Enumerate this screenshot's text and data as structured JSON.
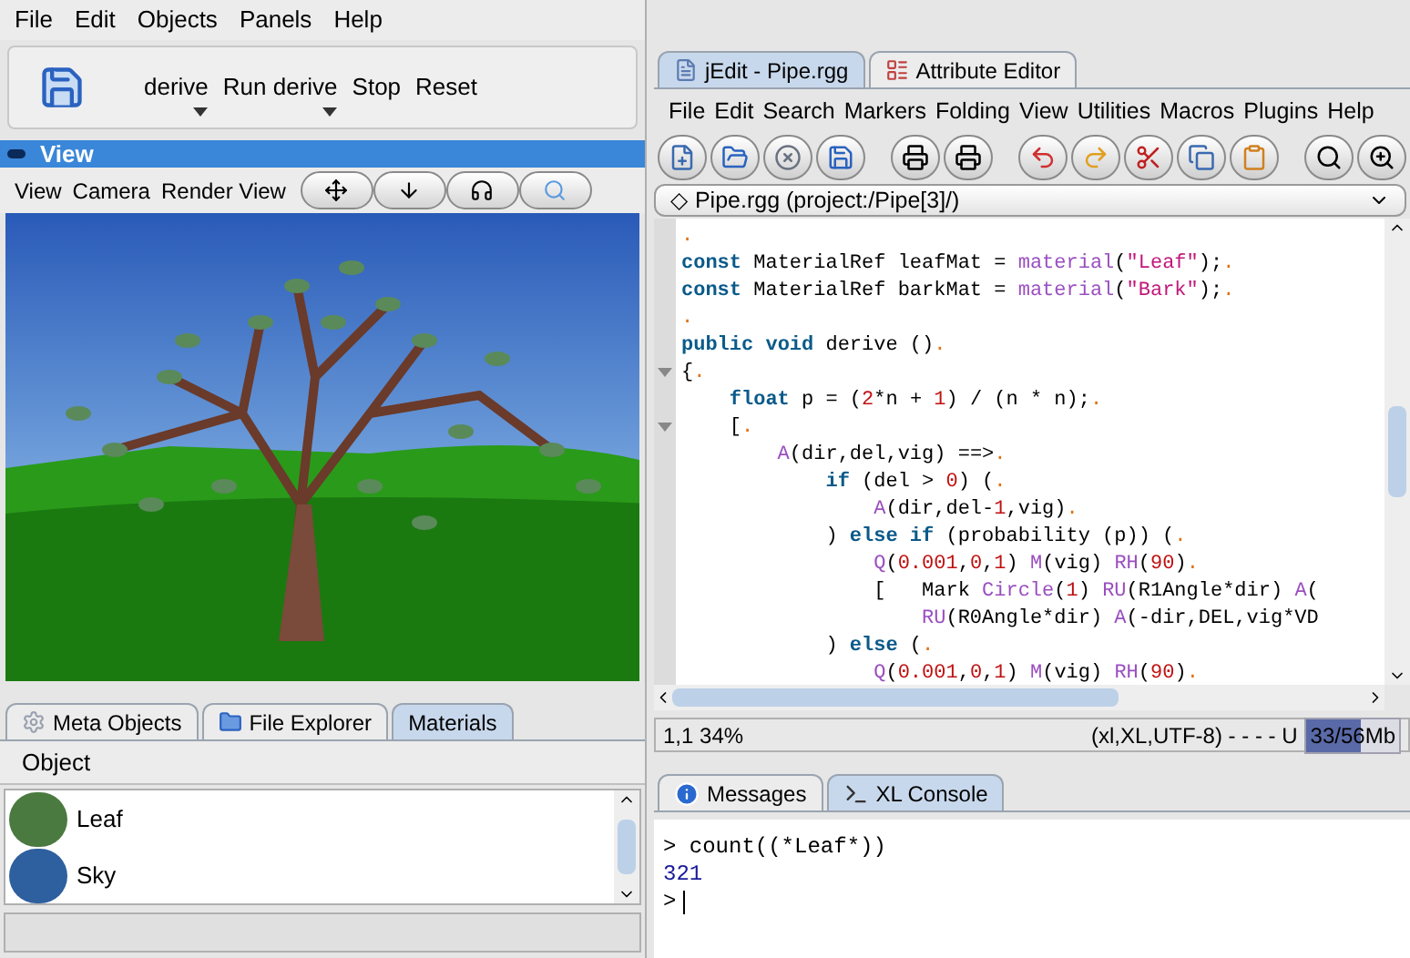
{
  "menu_bar": [
    "File",
    "Edit",
    "Objects",
    "Panels",
    "Help"
  ],
  "toolbar": [
    {
      "label": "derive",
      "dropdown": true
    },
    {
      "label": "Run derive",
      "dropdown": true
    },
    {
      "label": "Stop",
      "dropdown": false
    },
    {
      "label": "Reset",
      "dropdown": false
    }
  ],
  "view_panel": {
    "title": "View",
    "menu": [
      "View",
      "Camera",
      "Render View"
    ]
  },
  "bottom_tabs": [
    {
      "label": "Meta Objects",
      "selected": false
    },
    {
      "label": "File Explorer",
      "selected": false
    },
    {
      "label": "Materials",
      "selected": true
    }
  ],
  "materials": {
    "menu": "Object",
    "items": [
      {
        "name": "Leaf",
        "color": "#4a7a40"
      },
      {
        "name": "Sky",
        "color": "#2e5f9e"
      }
    ]
  },
  "editor_tabs": [
    {
      "label": "jEdit - Pipe.rgg",
      "selected": true
    },
    {
      "label": "Attribute Editor",
      "selected": false
    }
  ],
  "editor_menu": [
    "File",
    "Edit",
    "Search",
    "Markers",
    "Folding",
    "View",
    "Utilities",
    "Macros",
    "Plugins",
    "Help"
  ],
  "buffer": "◇ Pipe.rgg (project:/Pipe[3]/)",
  "code": [
    {
      "fold": false,
      "tokens": [
        {
          "kind": "eol",
          "text": "."
        }
      ]
    },
    {
      "fold": false,
      "tokens": [
        {
          "kind": "kw",
          "text": "const"
        },
        {
          "kind": "plain",
          "text": " MaterialRef leafMat = "
        },
        {
          "kind": "fn",
          "text": "material"
        },
        {
          "kind": "plain",
          "text": "("
        },
        {
          "kind": "str",
          "text": "\"Leaf\""
        },
        {
          "kind": "plain",
          "text": ");"
        },
        {
          "kind": "eol",
          "text": "."
        }
      ]
    },
    {
      "fold": false,
      "tokens": [
        {
          "kind": "kw",
          "text": "const"
        },
        {
          "kind": "plain",
          "text": " MaterialRef barkMat = "
        },
        {
          "kind": "fn",
          "text": "material"
        },
        {
          "kind": "plain",
          "text": "("
        },
        {
          "kind": "str",
          "text": "\"Bark\""
        },
        {
          "kind": "plain",
          "text": ");"
        },
        {
          "kind": "eol",
          "text": "."
        }
      ]
    },
    {
      "fold": false,
      "tokens": [
        {
          "kind": "eol",
          "text": "."
        }
      ]
    },
    {
      "fold": false,
      "tokens": [
        {
          "kind": "kw",
          "text": "public "
        },
        {
          "kind": "kw",
          "text": "void"
        },
        {
          "kind": "plain",
          "text": " derive ()"
        },
        {
          "kind": "eol",
          "text": "."
        }
      ]
    },
    {
      "fold": true,
      "tokens": [
        {
          "kind": "plain",
          "text": "{"
        },
        {
          "kind": "eol",
          "text": "."
        }
      ]
    },
    {
      "fold": false,
      "tokens": [
        {
          "kind": "kw",
          "text": "    float"
        },
        {
          "kind": "plain",
          "text": " p = ("
        },
        {
          "kind": "num",
          "text": "2"
        },
        {
          "kind": "plain",
          "text": "*n + "
        },
        {
          "kind": "num",
          "text": "1"
        },
        {
          "kind": "plain",
          "text": ") / (n * n);"
        },
        {
          "kind": "eol",
          "text": "."
        }
      ]
    },
    {
      "fold": true,
      "tokens": [
        {
          "kind": "plain",
          "text": "    ["
        },
        {
          "kind": "eol",
          "text": "."
        }
      ]
    },
    {
      "fold": false,
      "tokens": [
        {
          "kind": "fn",
          "text": "        A"
        },
        {
          "kind": "plain",
          "text": "(dir,del,vig) ==>"
        },
        {
          "kind": "eol",
          "text": "."
        }
      ]
    },
    {
      "fold": false,
      "tokens": [
        {
          "kind": "kw",
          "text": "            if"
        },
        {
          "kind": "plain",
          "text": " (del > "
        },
        {
          "kind": "num",
          "text": "0"
        },
        {
          "kind": "plain",
          "text": ") ("
        },
        {
          "kind": "eol",
          "text": "."
        }
      ]
    },
    {
      "fold": false,
      "tokens": [
        {
          "kind": "fn",
          "text": "                A"
        },
        {
          "kind": "plain",
          "text": "(dir,del-"
        },
        {
          "kind": "num",
          "text": "1"
        },
        {
          "kind": "plain",
          "text": ",vig)"
        },
        {
          "kind": "eol",
          "text": "."
        }
      ]
    },
    {
      "fold": false,
      "tokens": [
        {
          "kind": "plain",
          "text": "            ) "
        },
        {
          "kind": "kw",
          "text": "else if"
        },
        {
          "kind": "plain",
          "text": " (probability (p)) ("
        },
        {
          "kind": "eol",
          "text": "."
        }
      ]
    },
    {
      "fold": false,
      "tokens": [
        {
          "kind": "fn",
          "text": "                Q"
        },
        {
          "kind": "plain",
          "text": "("
        },
        {
          "kind": "num",
          "text": "0.001"
        },
        {
          "kind": "plain",
          "text": ","
        },
        {
          "kind": "num",
          "text": "0"
        },
        {
          "kind": "plain",
          "text": ","
        },
        {
          "kind": "num",
          "text": "1"
        },
        {
          "kind": "plain",
          "text": ") "
        },
        {
          "kind": "fn",
          "text": "M"
        },
        {
          "kind": "plain",
          "text": "(vig) "
        },
        {
          "kind": "fn",
          "text": "RH"
        },
        {
          "kind": "plain",
          "text": "("
        },
        {
          "kind": "num",
          "text": "90"
        },
        {
          "kind": "plain",
          "text": ")"
        },
        {
          "kind": "eol",
          "text": "."
        }
      ]
    },
    {
      "fold": false,
      "tokens": [
        {
          "kind": "plain",
          "text": "                [   Mark "
        },
        {
          "kind": "fn",
          "text": "Circle"
        },
        {
          "kind": "plain",
          "text": "("
        },
        {
          "kind": "num",
          "text": "1"
        },
        {
          "kind": "plain",
          "text": ") "
        },
        {
          "kind": "fn",
          "text": "RU"
        },
        {
          "kind": "plain",
          "text": "(R1Angle*dir) "
        },
        {
          "kind": "fn",
          "text": "A"
        },
        {
          "kind": "plain",
          "text": "("
        }
      ]
    },
    {
      "fold": false,
      "tokens": [
        {
          "kind": "fn",
          "text": "                    RU"
        },
        {
          "kind": "plain",
          "text": "(R0Angle*dir) "
        },
        {
          "kind": "fn",
          "text": "A"
        },
        {
          "kind": "plain",
          "text": "(-dir,DEL,vig*VD"
        }
      ]
    },
    {
      "fold": false,
      "tokens": [
        {
          "kind": "plain",
          "text": "            ) "
        },
        {
          "kind": "kw",
          "text": "else"
        },
        {
          "kind": "plain",
          "text": " ("
        },
        {
          "kind": "eol",
          "text": "."
        }
      ]
    },
    {
      "fold": false,
      "tokens": [
        {
          "kind": "fn",
          "text": "                Q"
        },
        {
          "kind": "plain",
          "text": "("
        },
        {
          "kind": "num",
          "text": "0.001"
        },
        {
          "kind": "plain",
          "text": ","
        },
        {
          "kind": "num",
          "text": "0"
        },
        {
          "kind": "plain",
          "text": ","
        },
        {
          "kind": "num",
          "text": "1"
        },
        {
          "kind": "plain",
          "text": ") "
        },
        {
          "kind": "fn",
          "text": "M"
        },
        {
          "kind": "plain",
          "text": "(vig) "
        },
        {
          "kind": "fn",
          "text": "RH"
        },
        {
          "kind": "plain",
          "text": "("
        },
        {
          "kind": "num",
          "text": "90"
        },
        {
          "kind": "plain",
          "text": ")"
        },
        {
          "kind": "eol",
          "text": "."
        }
      ]
    }
  ],
  "status": {
    "position": "1,1 34%",
    "mode": "(xl,XL,UTF-8) - - - - U",
    "memory": "33/56Mb",
    "level": 0.59
  },
  "console_tabs": [
    {
      "label": "Messages",
      "selected": false
    },
    {
      "label": "XL Console",
      "selected": true
    }
  ],
  "console": [
    {
      "kind": "input",
      "text": "> count((*Leaf*))"
    },
    {
      "kind": "output",
      "text": "321"
    },
    {
      "kind": "prompt",
      "text": ">"
    }
  ]
}
